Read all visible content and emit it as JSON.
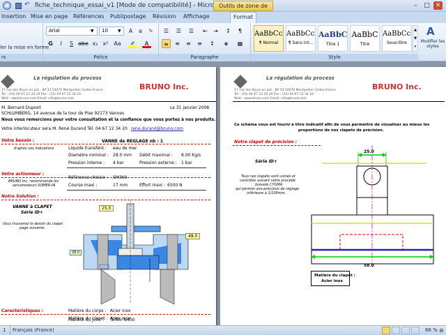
{
  "window": {
    "title": "fiche_technique_essai_v1 [Mode de compatibilité] - Microsoft Word",
    "context_tab": "Outils de zone de texte",
    "controls": [
      "–",
      "□",
      "✕"
    ]
  },
  "tabs": [
    "Insertion",
    "Mise en page",
    "Références",
    "Publipostage",
    "Révision",
    "Affichage",
    "Format"
  ],
  "ribbon": {
    "clipboard_item": "ler la mise en forme",
    "clipboard_group": "rs",
    "font_name": "Arial",
    "font_size": "10",
    "font_group": "Police",
    "paragraph_group": "Paragraphe",
    "styles_group": "Style",
    "styles": [
      {
        "preview": "AaBbCcI",
        "name": "¶ Normal"
      },
      {
        "preview": "AaBbCcI",
        "name": "¶ Sans int..."
      },
      {
        "preview": "AaBbC",
        "name": "Titre 1"
      },
      {
        "preview": "AaBbC",
        "name": "Titre"
      },
      {
        "preview": "AaBbCcI",
        "name": "Sous-titre"
      }
    ],
    "modify_styles": "Modifier les styles"
  },
  "page1": {
    "brand_title": "La régulation du process",
    "brand_name": "BRUNO Inc.",
    "addr1": "17 rue des fleurs en pot - BP 33 54070 Montpellier Cedex France",
    "addr2": "Tel : (33) 04 67 12 34 10 Fax : (33) 04 67 12 34 10",
    "addr3": "Web : www.bruno.com Email: info@bruno.com",
    "recipient": "M. Bernard Dupont",
    "date": "Le 31 janvier 2008",
    "company": "SCHLUMBERG, 14 avenue de la tour de Pise 92173 Vannes",
    "thanks": "Nous vous remercions pour votre consultation et la confiance que vous portez à nos produits.",
    "contact": "Votre interlocuteur sera M. René Durand  Tél. 04 67 12 34 20",
    "contact_email": "rene.durand@bruno.com",
    "besoin_label": "Votre besoin :",
    "besoin_note": "d'après vos indications",
    "vanne_title": "VANNE de REGLAGE  nb : 1",
    "liquide_label": "Liquide transféré :",
    "liquide_val": "eau de mer",
    "diam_label": "Diamètre nominal :",
    "diam_val": "28.0 mm",
    "debit_label": "Débit maximal :",
    "debit_val": "8.00 Kg/s",
    "pint_label": "Pression interne :",
    "pint_val": "4 bar",
    "pext_label": "Pression externe :",
    "pext_val": "1 bar",
    "actionneur_label": "Votre actionneur :",
    "actionneur_note1": "BRUNO Inc. recommande les",
    "actionneur_note2": "servomoteurs SOMER-IN.",
    "ref_label": "Référence choisie :",
    "ref_val": "SM360",
    "course_label": "Course maxi :",
    "course_val": "17 mm",
    "effort_label": "Effort maxi :",
    "effort_val": "6500 N",
    "solution_label": "Notre Solution :",
    "solution_title1": "VANNE à CLAPET",
    "solution_title2": "Série ID+",
    "solution_note1": "Vous trouverez le dessin du clapet",
    "solution_note2": "page suivante.",
    "dim_top": "25.0",
    "dim_right": "48.0",
    "dim_left": "28.0",
    "carac_label": "Caractéristiques :",
    "corps_label": "Matière du corps :",
    "corps_val": "Acier inox",
    "clapet_label": "Matière du clapet :",
    "clapet_val": "Acier inox",
    "joint_label": "Matière du joint :",
    "joint_val": "Teflon N400"
  },
  "page2": {
    "brand_title": "La régulation du process",
    "brand_name": "BRUNO Inc.",
    "addr1": "17 rue des fleurs en pot - BP 33 54070 Montpellier Cedex France",
    "addr2": "Tel : (33) 04 67 12 34 10 Fax : (33) 04 67 12 34 10",
    "addr3": "Web : www.bruno.com Email: info@bruno.com",
    "intro1": "Ce schéma vous est fourni à titre indicatif afin de vous permettre de visualiser au mieux les",
    "intro2": "proportions de nos clapets de précision.",
    "clapet_label": "Notre clapet de précision :",
    "serie": "Série ID+",
    "note1": "Tous nos clapets sont usinés et",
    "note2": "contrôlés suivant notre procédé",
    "note3": "breveté CYGMA",
    "note4": "qui permet une précision de réglage",
    "note5": "inférieure à 1/100mm.",
    "dim_top": "25.0",
    "dim_bottom": "58.0",
    "material_title": "Matière du clapet :",
    "material_val": "Acier inox"
  },
  "status": {
    "page": "1",
    "language": "Français (France)",
    "zoom": "66 %"
  }
}
